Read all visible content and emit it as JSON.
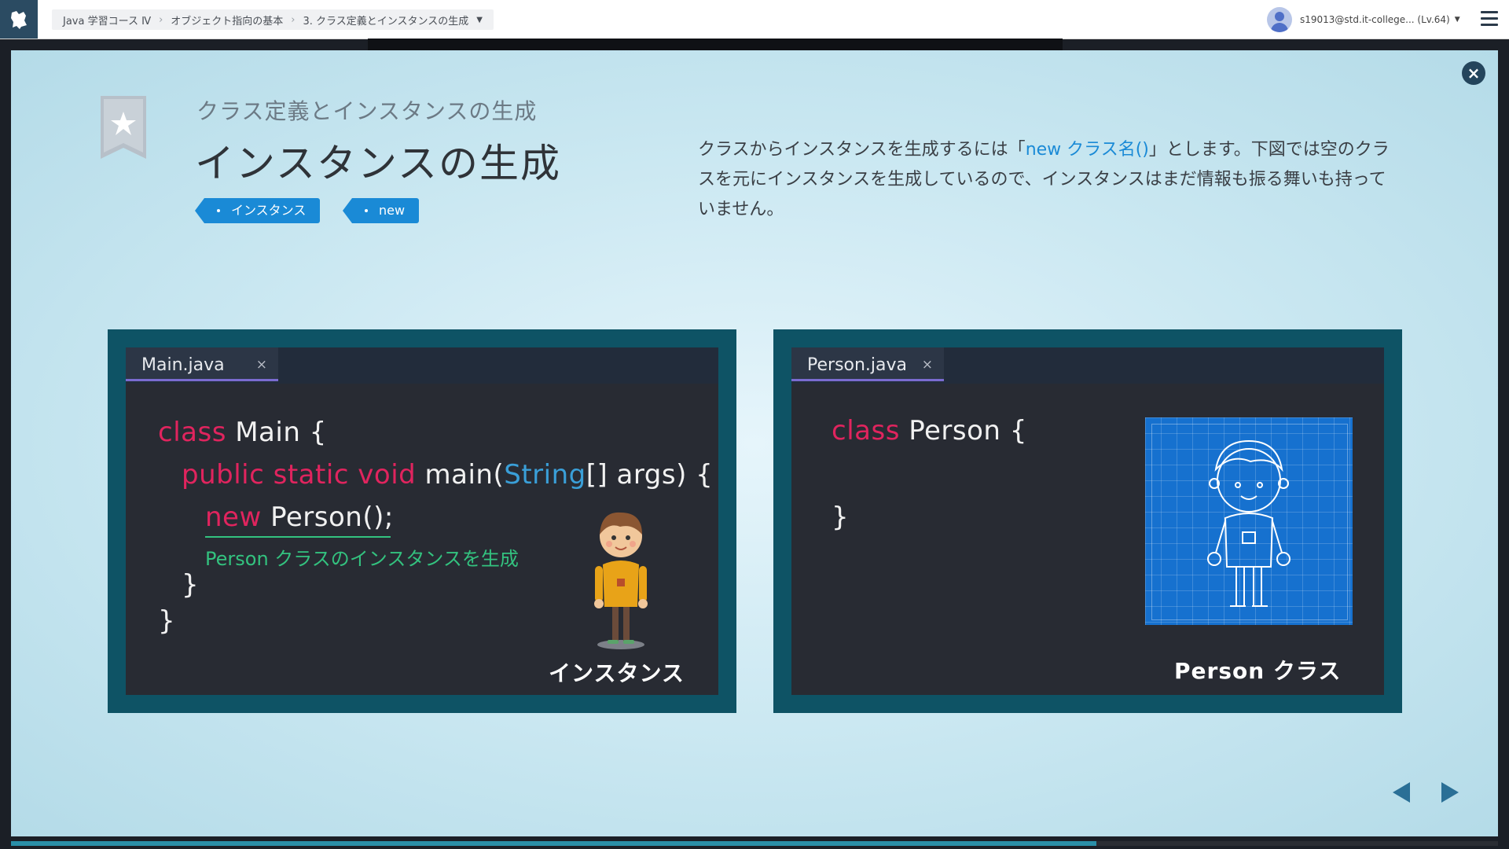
{
  "breadcrumb": {
    "course": "Java 学習コース Ⅳ",
    "chapter": "オブジェクト指向の基本",
    "lesson": "3. クラス定義とインスタンスの生成"
  },
  "user": {
    "label": "s19013@std.it-college... (Lv.64)"
  },
  "slide": {
    "subtitle": "クラス定義とインスタンスの生成",
    "title": "インスタンスの生成",
    "tags": [
      "インスタンス",
      "new"
    ],
    "description": {
      "before": "クラスからインスタンスを生成するには「",
      "highlight": "new クラス名()",
      "after": "」とします。下図では空のクラスを元にインスタンスを生成しているので、インスタンスはまだ情報も振る舞いも持っていません。"
    }
  },
  "main_editor": {
    "tab": "Main.java",
    "close_glyph": "×",
    "lines": {
      "l1_kw": "class",
      "l1_rest": " Main {",
      "l2_kw": "public static void",
      "l2_a": " main(",
      "l2_type": "String",
      "l2_b": "[] args) {",
      "l3_kw": "new",
      "l3_rest": " Person();",
      "l4": "}",
      "l5": "}"
    },
    "comment": "Person クラスのインスタンスを生成",
    "caption": "インスタンス"
  },
  "person_editor": {
    "tab": "Person.java",
    "close_glyph": "×",
    "lines": {
      "l1_kw": "class",
      "l1_rest": " Person {",
      "l2": "}"
    },
    "caption": "Person クラス"
  },
  "progress": {
    "fraction": 0.73
  },
  "colors": {
    "accent": "#1a8ad6",
    "keyword": "#e0245e",
    "type": "#3a9fd8",
    "comment": "#33c27f",
    "card": "#0e5365"
  },
  "icons": [
    "app-logo-icon",
    "chevron-right-icon",
    "caret-down-icon",
    "user-avatar-icon",
    "hamburger-menu-icon",
    "close-icon",
    "star-bookmark-icon",
    "arrow-left-icon",
    "arrow-right-icon"
  ]
}
